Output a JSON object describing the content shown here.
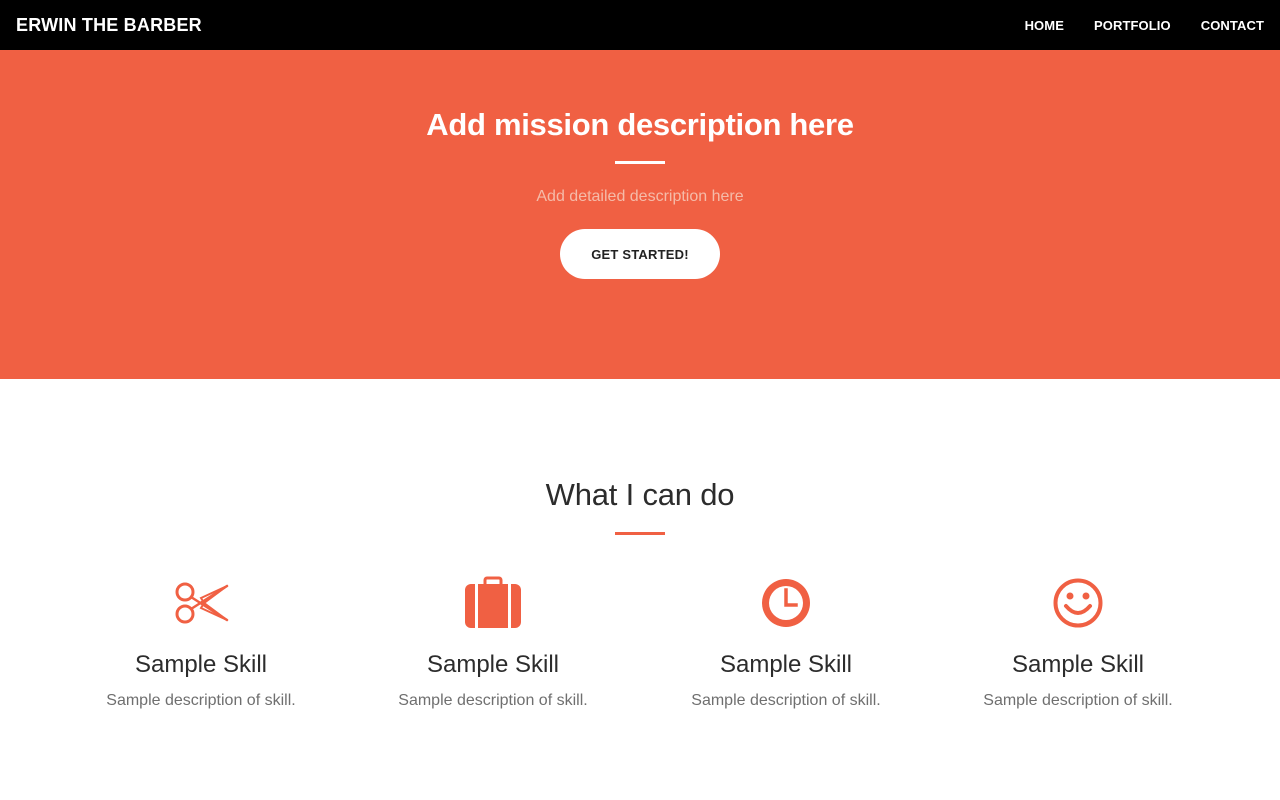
{
  "colors": {
    "accent": "#F06043",
    "hero_subtext": "#F5BBA9",
    "navbar_bg": "#000000"
  },
  "navbar": {
    "brand": "ERWIN THE BARBER",
    "links": [
      {
        "label": "HOME"
      },
      {
        "label": "PORTFOLIO"
      },
      {
        "label": "CONTACT"
      }
    ]
  },
  "hero": {
    "title": "Add mission description here",
    "subtitle": "Add detailed description here",
    "button_label": "GET STARTED!"
  },
  "skills": {
    "title": "What I can do",
    "items": [
      {
        "icon": "scissors-icon",
        "title": "Sample Skill",
        "description": "Sample description of skill."
      },
      {
        "icon": "briefcase-icon",
        "title": "Sample Skill",
        "description": "Sample description of skill."
      },
      {
        "icon": "clock-icon",
        "title": "Sample Skill",
        "description": "Sample description of skill."
      },
      {
        "icon": "smiley-icon",
        "title": "Sample Skill",
        "description": "Sample description of skill."
      }
    ]
  }
}
